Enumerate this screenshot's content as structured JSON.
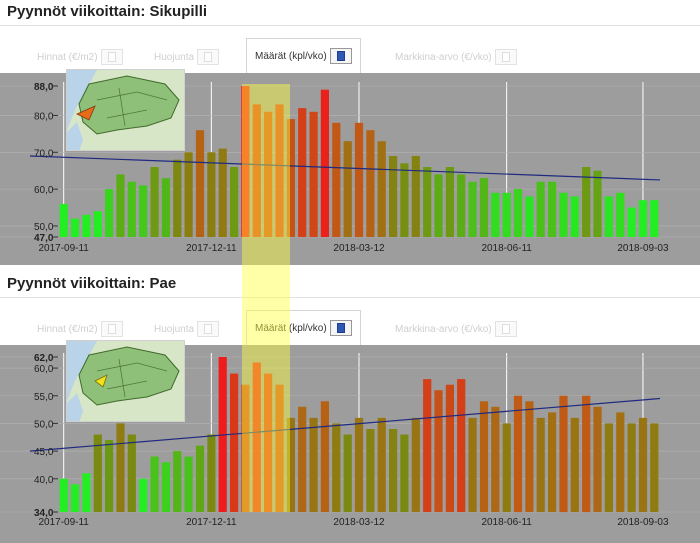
{
  "panels": [
    {
      "title": "Pyynnöt viikoittain: Sikupilli",
      "tabs": [
        {
          "label": "Hinnat (€/m2)",
          "active": false
        },
        {
          "label": "Huojunta",
          "active": false
        },
        {
          "label": "Määrät (kpl/vko)",
          "active": true
        },
        {
          "label": "Markkina-arvo (€/vko)",
          "active": false
        }
      ],
      "map_icon": "district-map-thumbnail"
    },
    {
      "title": "Pyynnöt viikoittain: Pae",
      "tabs": [
        {
          "label": "Hinnat (€/m2)",
          "active": false
        },
        {
          "label": "Huojunta",
          "active": false
        },
        {
          "label": "Määrät (kpl/vko)",
          "active": true
        },
        {
          "label": "Markkina-arvo (€/vko)",
          "active": false
        }
      ],
      "map_icon": "district-map-thumbnail"
    }
  ],
  "chart_data": [
    {
      "type": "bar",
      "background": "#9d9d9d",
      "trendline_color": "#1f2a80",
      "color_scale": [
        "#22ee22",
        "#7a8a10",
        "#c05a15",
        "#ee1c1c"
      ],
      "ylim": [
        47.0,
        88.0
      ],
      "yticks": [
        "47,0",
        "50,0",
        "60,0",
        "70,0",
        "80,0",
        "88,0"
      ],
      "ytick_values": [
        47,
        50,
        60,
        70,
        80,
        88
      ],
      "xtick_labels": [
        "2017-09-11",
        "2017-12-11",
        "2018-03-12",
        "2018-06-11",
        "2018-09-03"
      ],
      "xtick_index": [
        0,
        13,
        26,
        39,
        51
      ],
      "values": [
        56,
        52,
        53,
        54,
        60,
        64,
        62,
        61,
        66,
        63,
        68,
        70,
        76,
        70,
        71,
        66,
        88,
        83,
        81,
        83,
        79,
        82,
        81,
        87,
        78,
        73,
        78,
        76,
        73,
        69,
        67,
        69,
        66,
        64,
        66,
        64,
        62,
        63,
        59,
        59,
        60,
        58,
        62,
        62,
        59,
        58,
        66,
        65,
        58,
        59,
        55,
        57,
        57
      ],
      "trend": [
        69.0,
        62.5
      ],
      "grid": true
    },
    {
      "type": "bar",
      "background": "#9d9d9d",
      "trendline_color": "#1f2a80",
      "color_scale": [
        "#22ee22",
        "#7a8a10",
        "#c05a15",
        "#ee1c1c"
      ],
      "ylim": [
        34.0,
        62.0
      ],
      "yticks": [
        "34,0",
        "40,0",
        "45,0",
        "50,0",
        "55,0",
        "60,0",
        "62,0"
      ],
      "ytick_values": [
        34,
        40,
        45,
        50,
        55,
        60,
        62
      ],
      "xtick_labels": [
        "2017-09-11",
        "2017-12-11",
        "2018-03-12",
        "2018-06-11",
        "2018-09-03"
      ],
      "xtick_index": [
        0,
        13,
        26,
        39,
        51
      ],
      "values": [
        40,
        39,
        41,
        48,
        47,
        50,
        48,
        40,
        44,
        43,
        45,
        44,
        46,
        48,
        62,
        59,
        57,
        61,
        59,
        57,
        51,
        53,
        51,
        54,
        50,
        48,
        51,
        49,
        51,
        49,
        48,
        51,
        58,
        56,
        57,
        58,
        51,
        54,
        53,
        50,
        55,
        54,
        51,
        52,
        55,
        51,
        55,
        53,
        50,
        52,
        50,
        51,
        50
      ],
      "trend": [
        45.0,
        54.5
      ],
      "grid": true
    }
  ]
}
